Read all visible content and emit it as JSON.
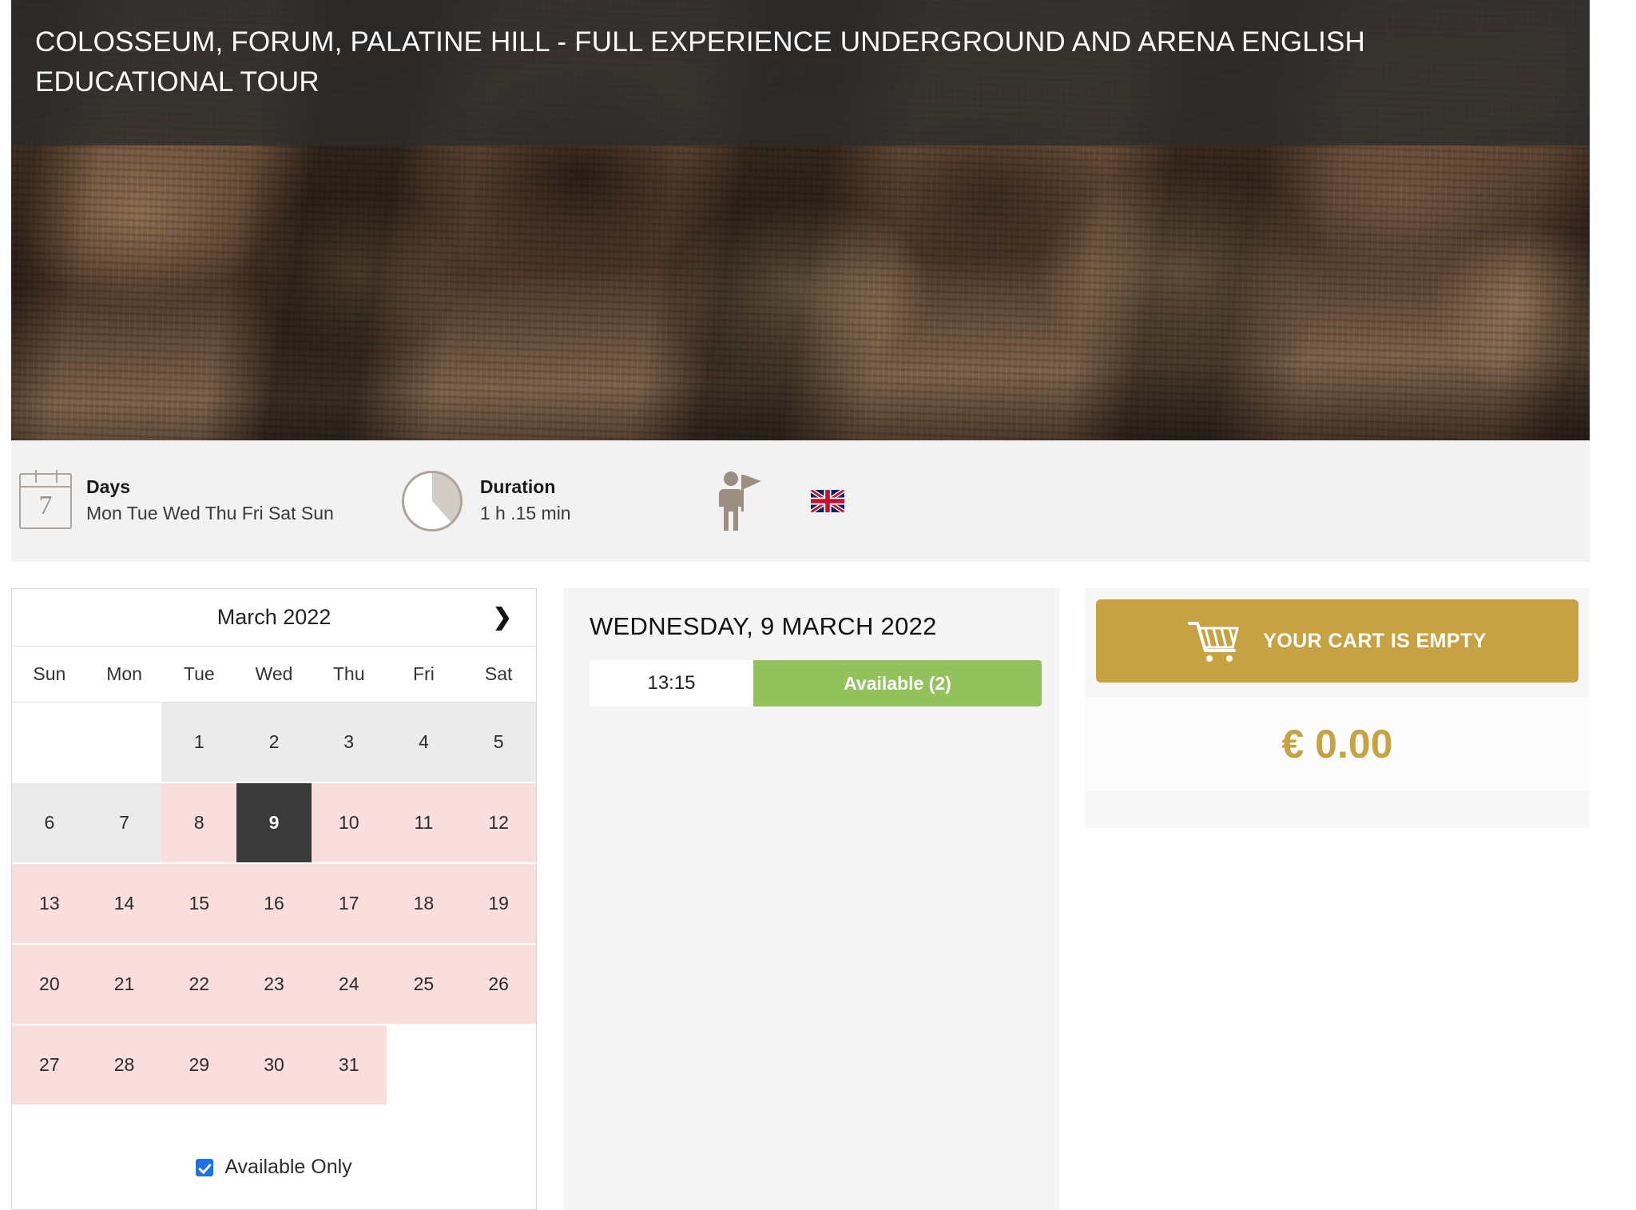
{
  "hero": {
    "title": "COLOSSEUM, FORUM, PALATINE HILL - FULL EXPERIENCE UNDERGROUND AND ARENA ENGLISH EDUCATIONAL TOUR",
    "photo_alt": "colosseum-underground-photo"
  },
  "info": {
    "days": {
      "icon": "calendar-icon",
      "icon_number": "7",
      "label": "Days",
      "value": "Mon Tue Wed Thu Fri Sat Sun"
    },
    "duration": {
      "icon": "pie-clock-icon",
      "label": "Duration",
      "value": "1 h .15 min"
    },
    "guide_icon": "tour-guide-icon",
    "language_icon": "uk-flag-icon"
  },
  "calendar": {
    "month_label": "March 2022",
    "next_icon": "chevron-right-icon",
    "prev_icon": "chevron-left-icon",
    "weekdays": [
      "Sun",
      "Mon",
      "Tue",
      "Wed",
      "Thu",
      "Fri",
      "Sat"
    ],
    "weeks": [
      [
        {
          "day": "",
          "state": "empty"
        },
        {
          "day": "",
          "state": "empty"
        },
        {
          "day": "1",
          "state": "past"
        },
        {
          "day": "2",
          "state": "past"
        },
        {
          "day": "3",
          "state": "past"
        },
        {
          "day": "4",
          "state": "past"
        },
        {
          "day": "5",
          "state": "past"
        }
      ],
      [
        {
          "day": "6",
          "state": "past"
        },
        {
          "day": "7",
          "state": "past"
        },
        {
          "day": "8",
          "state": "avail"
        },
        {
          "day": "9",
          "state": "selected"
        },
        {
          "day": "10",
          "state": "avail"
        },
        {
          "day": "11",
          "state": "avail"
        },
        {
          "day": "12",
          "state": "avail"
        }
      ],
      [
        {
          "day": "13",
          "state": "avail"
        },
        {
          "day": "14",
          "state": "avail"
        },
        {
          "day": "15",
          "state": "avail"
        },
        {
          "day": "16",
          "state": "avail"
        },
        {
          "day": "17",
          "state": "avail"
        },
        {
          "day": "18",
          "state": "avail"
        },
        {
          "day": "19",
          "state": "avail"
        }
      ],
      [
        {
          "day": "20",
          "state": "avail"
        },
        {
          "day": "21",
          "state": "avail"
        },
        {
          "day": "22",
          "state": "avail"
        },
        {
          "day": "23",
          "state": "avail"
        },
        {
          "day": "24",
          "state": "avail"
        },
        {
          "day": "25",
          "state": "avail"
        },
        {
          "day": "26",
          "state": "avail"
        }
      ],
      [
        {
          "day": "27",
          "state": "avail"
        },
        {
          "day": "28",
          "state": "avail"
        },
        {
          "day": "29",
          "state": "avail"
        },
        {
          "day": "30",
          "state": "avail"
        },
        {
          "day": "31",
          "state": "avail"
        },
        {
          "day": "",
          "state": "empty"
        },
        {
          "day": "",
          "state": "empty"
        }
      ]
    ],
    "available_only": {
      "label": "Available Only",
      "checked": true
    }
  },
  "slots": {
    "date_title": "WEDNESDAY, 9 MARCH 2022",
    "rows": [
      {
        "time": "13:15",
        "status": "Available (2)"
      }
    ]
  },
  "cart": {
    "icon": "shopping-cart-icon",
    "empty_label": "YOUR CART IS EMPTY",
    "total": "€ 0.00"
  },
  "colors": {
    "gold": "#C7A243",
    "green": "#93C25C",
    "selected_day": "#3A3A3A",
    "available_day": "#FADEDE",
    "past_day": "#EBEBEB",
    "checkbox_blue": "#1A73E8"
  }
}
